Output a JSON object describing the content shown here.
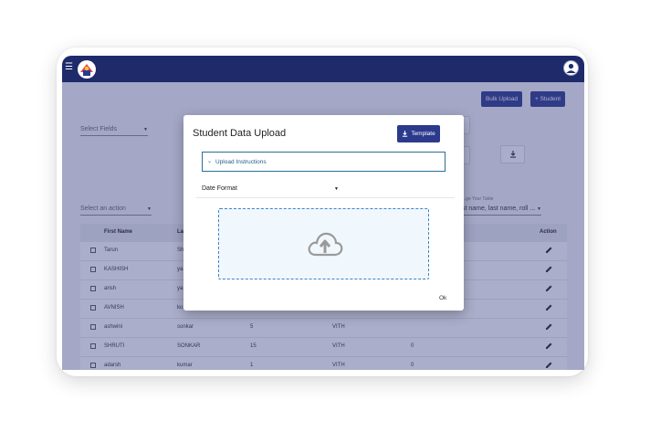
{
  "topbar": {
    "menu_icon": "hamburger-icon",
    "logo_icon": "school-logo-icon",
    "avatar_icon": "user-avatar-icon"
  },
  "toolbar": {
    "bulk_upload": "Bulk Upload",
    "add_student": "+ Student"
  },
  "filters": {
    "select_fields": "Select Fields",
    "select_action": "Select an action",
    "arrange_label": "...ge Your Table",
    "arrange_value": "st name, last name, roll ..."
  },
  "table": {
    "headers": [
      "First Name",
      "La...",
      "",
      "",
      "",
      "Action"
    ],
    "rows": [
      [
        "Tarun",
        "Sh...",
        "",
        "",
        ""
      ],
      [
        "KASHISH",
        "ya...",
        "",
        "",
        ""
      ],
      [
        "ansh",
        "ya...",
        "",
        "",
        ""
      ],
      [
        "AVNISH",
        "ku...",
        "",
        "",
        ""
      ],
      [
        "ashwini",
        "sonkar",
        "5",
        "VITH",
        ""
      ],
      [
        "SHRUTI",
        "SONKAR",
        "15",
        "VITH",
        "0"
      ],
      [
        "adarsh",
        "kumar",
        "1",
        "VITH",
        "0"
      ]
    ]
  },
  "modal": {
    "title": "Student Data Upload",
    "template_button": "Template",
    "upload_instructions": "Upload Instructions",
    "date_format": "Date Format",
    "ok": "Ok"
  },
  "colors": {
    "navbar": "#1f2a6b",
    "primary": "#2b3a8c",
    "dropzone_border": "#3e82c4"
  }
}
